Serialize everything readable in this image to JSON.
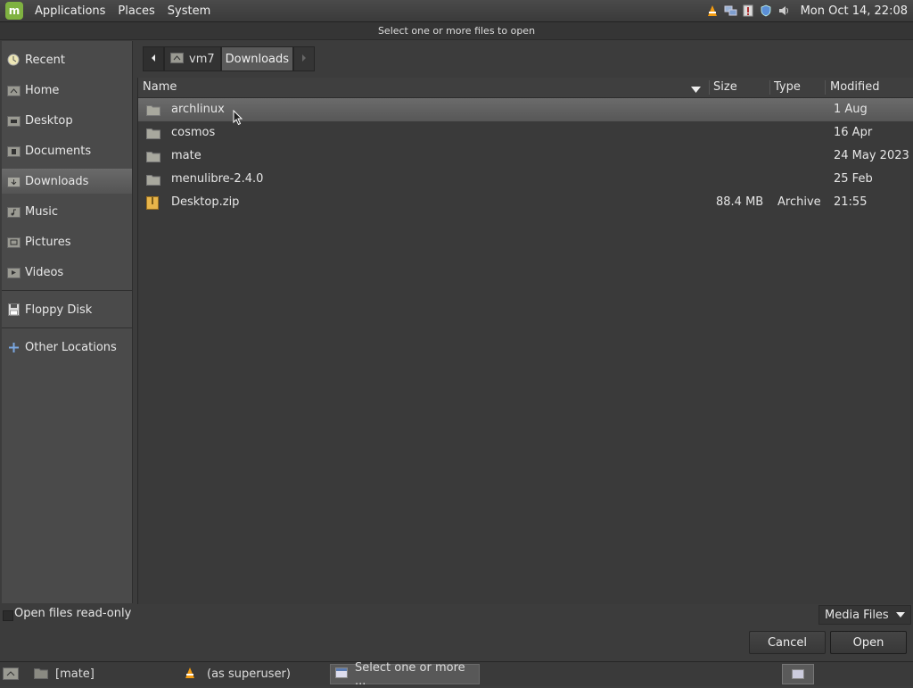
{
  "top_panel": {
    "menus": [
      "Applications",
      "Places",
      "System"
    ],
    "clock": "Mon Oct 14, 22:08"
  },
  "window": {
    "title": "Select one or more files to open"
  },
  "sidebar": {
    "items": [
      {
        "label": "Recent",
        "icon": "recent-icon"
      },
      {
        "label": "Home",
        "icon": "home-icon"
      },
      {
        "label": "Desktop",
        "icon": "desktop-folder-icon"
      },
      {
        "label": "Documents",
        "icon": "documents-folder-icon"
      },
      {
        "label": "Downloads",
        "icon": "downloads-folder-icon",
        "active": true
      },
      {
        "label": "Music",
        "icon": "music-folder-icon"
      },
      {
        "label": "Pictures",
        "icon": "pictures-folder-icon"
      },
      {
        "label": "Videos",
        "icon": "videos-folder-icon"
      },
      {
        "label": "Floppy Disk",
        "icon": "floppy-icon"
      },
      {
        "label": "Other Locations",
        "icon": "other-locations-icon"
      }
    ]
  },
  "pathbar": {
    "segments": [
      "vm7",
      "Downloads"
    ]
  },
  "filelist": {
    "columns": {
      "name": "Name",
      "size": "Size",
      "type": "Type",
      "modified": "Modified"
    },
    "rows": [
      {
        "name": "archlinux",
        "size": "",
        "type": "",
        "modified": "1 Aug",
        "kind": "folder"
      },
      {
        "name": "cosmos",
        "size": "",
        "type": "",
        "modified": "16 Apr",
        "kind": "folder"
      },
      {
        "name": "mate",
        "size": "",
        "type": "",
        "modified": "24 May 2023",
        "kind": "folder"
      },
      {
        "name": "menulibre-2.4.0",
        "size": "",
        "type": "",
        "modified": "25 Feb",
        "kind": "folder"
      },
      {
        "name": "Desktop.zip",
        "size": "88.4 MB",
        "type": "Archive",
        "modified": "21:55",
        "kind": "archive"
      }
    ]
  },
  "options": {
    "read_only_label": "Open files read-only",
    "filter_value": "Media Files"
  },
  "buttons": {
    "cancel": "Cancel",
    "open": "Open"
  },
  "taskbar": {
    "tasks": [
      "[mate]",
      "(as superuser)",
      "Select one or more ..."
    ]
  },
  "colors": {
    "accent_green": "#7fb241",
    "selection": "#5f5f5f",
    "vlc_orange": "#f39c12"
  }
}
